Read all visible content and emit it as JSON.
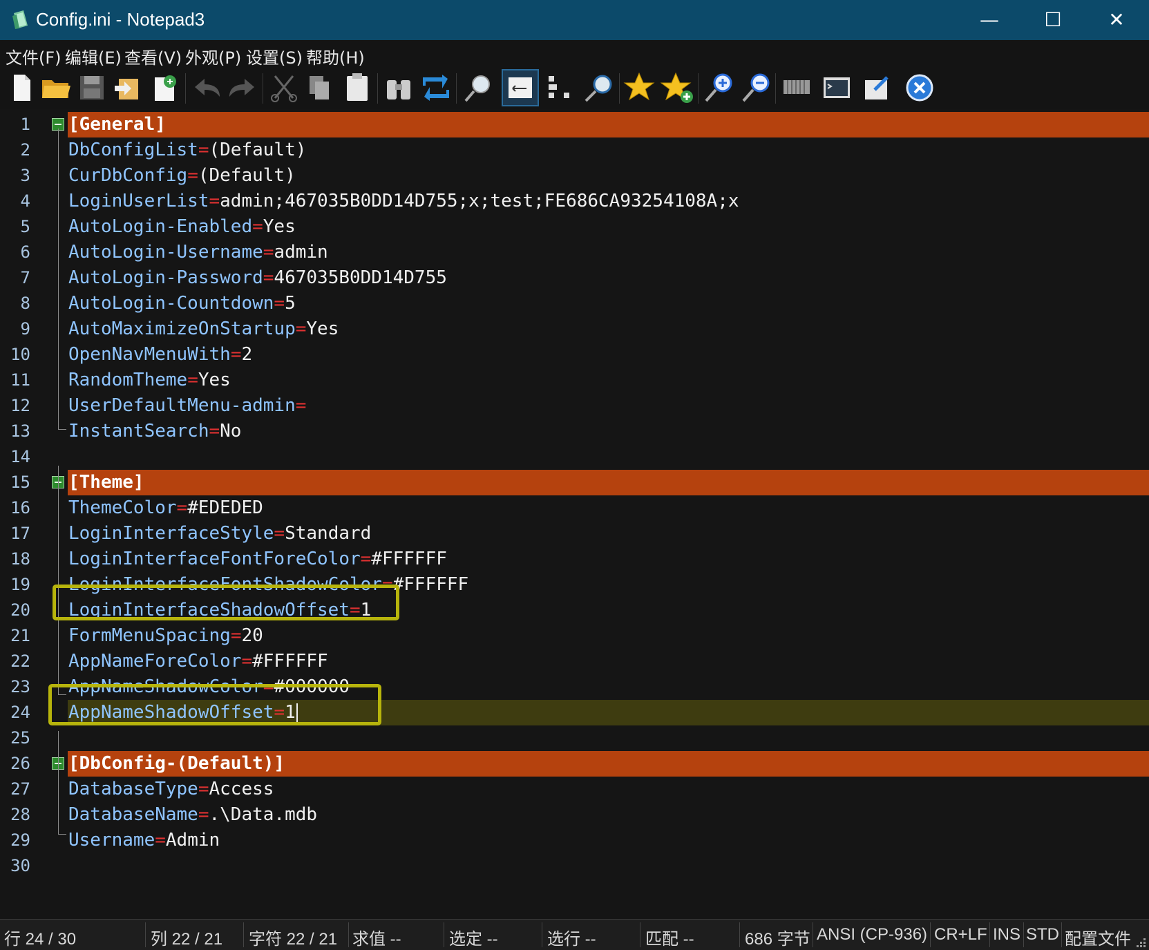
{
  "window": {
    "title": "Config.ini - Notepad3",
    "controls": {
      "minimize": "—",
      "maximize": "☐",
      "close": "✕"
    }
  },
  "menu": [
    {
      "label": "文件(F)"
    },
    {
      "label": "编辑(E)"
    },
    {
      "label": "查看(V)"
    },
    {
      "label": "外观(P)"
    },
    {
      "label": "设置(S)"
    },
    {
      "label": "帮助(H)"
    }
  ],
  "toolbar": [
    "new-file-icon",
    "open-folder-icon",
    "save-icon",
    "save-as-icon",
    "find-file-icon",
    "undo-icon",
    "redo-icon",
    "cut-icon",
    "copy-icon",
    "paste-icon",
    "find-icon",
    "replace-icon",
    "zoom-search-icon",
    "word-wrap-icon",
    "sort-icon",
    "find-next-icon",
    "bookmark-star-icon",
    "add-bookmark-star-icon",
    "zoom-in-icon",
    "zoom-out-icon",
    "schema-icon",
    "terminal-icon",
    "pin-icon",
    "exit-icon"
  ],
  "colors": {
    "section_bg": "#b5420e",
    "current_line_bg": "#3e3c10",
    "key": "#8fc4ff",
    "equals": "#e03131",
    "highlight_box": "#b7b40c",
    "title_bar": "#0c4a6a"
  },
  "lines": [
    {
      "n": "1",
      "type": "section",
      "text": "[General]"
    },
    {
      "n": "2",
      "key": "DbConfigList",
      "eq": "=",
      "val": "(Default)"
    },
    {
      "n": "3",
      "key": "CurDbConfig",
      "eq": "=",
      "val": "(Default)"
    },
    {
      "n": "4",
      "key": "LoginUserList",
      "eq": "=",
      "val": "admin;467035B0DD14D755;x;test;FE686CA93254108A;x"
    },
    {
      "n": "5",
      "key": "AutoLogin-Enabled",
      "eq": "=",
      "val": "Yes"
    },
    {
      "n": "6",
      "key": "AutoLogin-Username",
      "eq": "=",
      "val": "admin"
    },
    {
      "n": "7",
      "key": "AutoLogin-Password",
      "eq": "=",
      "val": "467035B0DD14D755"
    },
    {
      "n": "8",
      "key": "AutoLogin-Countdown",
      "eq": "=",
      "val": "5"
    },
    {
      "n": "9",
      "key": "AutoMaximizeOnStartup",
      "eq": "=",
      "val": "Yes"
    },
    {
      "n": "10",
      "key": "OpenNavMenuWith",
      "eq": "=",
      "val": "2"
    },
    {
      "n": "11",
      "key": "RandomTheme",
      "eq": "=",
      "val": "Yes"
    },
    {
      "n": "12",
      "key": "UserDefaultMenu-admin",
      "eq": "=",
      "val": ""
    },
    {
      "n": "13",
      "key": "InstantSearch",
      "eq": "=",
      "val": "No"
    },
    {
      "n": "14",
      "type": "empty"
    },
    {
      "n": "15",
      "type": "section",
      "text": "[Theme]"
    },
    {
      "n": "16",
      "key": "ThemeColor",
      "eq": "=",
      "val": "#EDEDED"
    },
    {
      "n": "17",
      "key": "LoginInterfaceStyle",
      "eq": "=",
      "val": "Standard"
    },
    {
      "n": "18",
      "key": "LoginInterfaceFontForeColor",
      "eq": "=",
      "val": "#FFFFFF"
    },
    {
      "n": "19",
      "key": "LoginInterfaceFontShadowColor",
      "eq": "=",
      "val": "#FFFFFF"
    },
    {
      "n": "20",
      "key": "LoginInterfaceShadowOffset",
      "eq": "=",
      "val": "1"
    },
    {
      "n": "21",
      "key": "FormMenuSpacing",
      "eq": "=",
      "val": "20"
    },
    {
      "n": "22",
      "key": "AppNameForeColor",
      "eq": "=",
      "val": "#FFFFFF"
    },
    {
      "n": "23",
      "key": "AppNameShadowColor",
      "eq": "=",
      "val": "#000000"
    },
    {
      "n": "24",
      "key": "AppNameShadowOffset",
      "eq": "=",
      "val": "1",
      "current": true
    },
    {
      "n": "25",
      "type": "empty"
    },
    {
      "n": "26",
      "type": "section",
      "text": "[DbConfig-(Default)]"
    },
    {
      "n": "27",
      "key": "DatabaseType",
      "eq": "=",
      "val": "Access"
    },
    {
      "n": "28",
      "key": "DatabaseName",
      "eq": "=",
      "val": ".\\Data.mdb"
    },
    {
      "n": "29",
      "key": "Username",
      "eq": "=",
      "val": "Admin"
    },
    {
      "n": "30",
      "type": "empty"
    }
  ],
  "status": {
    "line": "行  24 / 30",
    "col": "列  22 / 21",
    "char": "字符  22 / 21",
    "eval": "求值  --",
    "sel": "选定  --",
    "sel_lines": "选行  --",
    "match": "匹配  --",
    "size": "686 字节",
    "encoding": "ANSI (CP-936)",
    "eol": "CR+LF",
    "ovr": "INS",
    "mode": "STD",
    "scheme": "配置文件"
  }
}
